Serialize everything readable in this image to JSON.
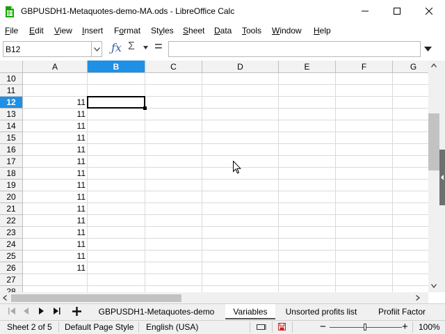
{
  "window": {
    "title": "GBPUSDH1-Metaquotes-demo-MA.ods - LibreOffice Calc",
    "app_icon": "calc-sheet-icon",
    "controls": [
      "minimize-icon",
      "maximize-icon",
      "close-icon"
    ]
  },
  "menu": {
    "items": [
      {
        "label": "File",
        "accel": "F"
      },
      {
        "label": "Edit",
        "accel": "E"
      },
      {
        "label": "View",
        "accel": "V"
      },
      {
        "label": "Insert",
        "accel": "I"
      },
      {
        "label": "Format",
        "accel": "o"
      },
      {
        "label": "Styles",
        "accel": "y"
      },
      {
        "label": "Sheet",
        "accel": "S"
      },
      {
        "label": "Data",
        "accel": "D"
      },
      {
        "label": "Tools",
        "accel": "T"
      },
      {
        "label": "Window",
        "accel": "W"
      },
      {
        "label": "Help",
        "accel": "H"
      }
    ]
  },
  "formula_bar": {
    "name_box": "B12",
    "function_wizard_icon": "fx-icon",
    "sum_icon": "sigma-icon",
    "formula_icon": "equals-icon",
    "content": ""
  },
  "grid": {
    "columns": [
      "A",
      "B",
      "C",
      "D",
      "E",
      "F",
      "G"
    ],
    "selected_column": "B",
    "selected_row": "12",
    "active_cell": "B12",
    "rows": [
      {
        "row": "10",
        "a": ""
      },
      {
        "row": "11",
        "a": ""
      },
      {
        "row": "12",
        "a": "11"
      },
      {
        "row": "13",
        "a": "11"
      },
      {
        "row": "14",
        "a": "11"
      },
      {
        "row": "15",
        "a": "11"
      },
      {
        "row": "16",
        "a": "11"
      },
      {
        "row": "17",
        "a": "11"
      },
      {
        "row": "18",
        "a": "11"
      },
      {
        "row": "19",
        "a": "11"
      },
      {
        "row": "20",
        "a": "11"
      },
      {
        "row": "21",
        "a": "11"
      },
      {
        "row": "22",
        "a": "11"
      },
      {
        "row": "23",
        "a": "11"
      },
      {
        "row": "24",
        "a": "11"
      },
      {
        "row": "25",
        "a": "11"
      },
      {
        "row": "26",
        "a": "11"
      },
      {
        "row": "27",
        "a": ""
      },
      {
        "row": "28",
        "a": ""
      }
    ]
  },
  "sheet_tabs": {
    "add_icon": "plus-icon",
    "tabs": [
      {
        "label": "GBPUSDH1-Metaquotes-demo",
        "active": false
      },
      {
        "label": "Variables",
        "active": true
      },
      {
        "label": "Unsorted profits list",
        "active": false
      },
      {
        "label": "Profiit Factor",
        "active": false
      }
    ]
  },
  "status_bar": {
    "sheet_info": "Sheet 2 of 5",
    "page_style": "Default Page Style",
    "language": "English (USA)",
    "zoom": "100%",
    "zoom_level": 100
  },
  "colors": {
    "selection_header": "#1e90e6",
    "accent_icon": "#3465a4",
    "save_icon": "#c9211e",
    "calc_icon": "#18a303"
  }
}
